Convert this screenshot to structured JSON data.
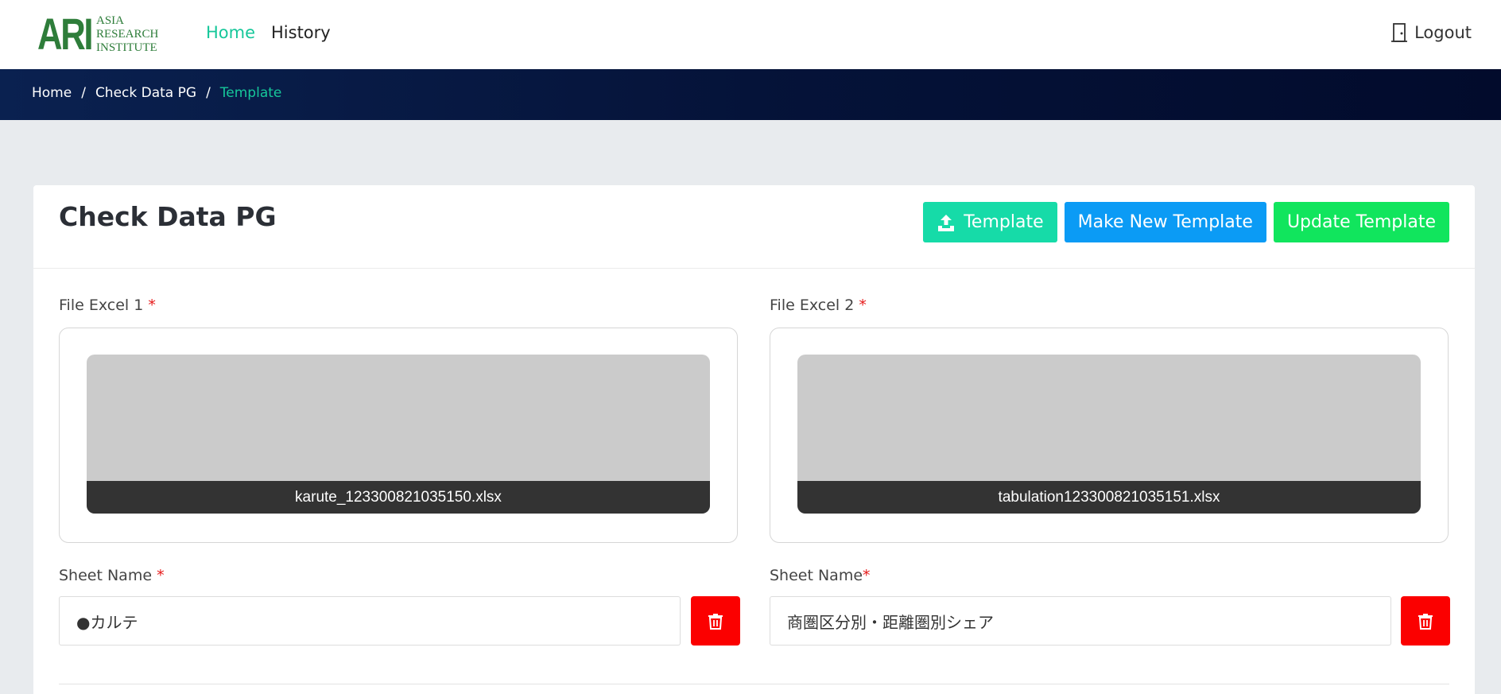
{
  "logo": {
    "mark": "ARI",
    "line1": "ASIA",
    "line2": "RESEARCH",
    "line3": "INSTITUTE"
  },
  "nav": {
    "home": "Home",
    "history": "History",
    "logout": "Logout"
  },
  "breadcrumb": {
    "home": "Home",
    "section": "Check Data PG",
    "current": "Template",
    "separator": "/"
  },
  "page": {
    "title": "Check Data PG",
    "buttons": {
      "template": "Template",
      "make_new": "Make New Template",
      "update": "Update Template"
    }
  },
  "file1": {
    "label": "File Excel 1",
    "required": "*",
    "filename": "karute_123300821035150.xlsx"
  },
  "file2": {
    "label": "File Excel 2",
    "required": "*",
    "filename": "tabulation123300821035151.xlsx"
  },
  "sheet1": {
    "label": "Sheet Name",
    "required": "*",
    "value": "●カルテ"
  },
  "sheet2": {
    "label": "Sheet Name",
    "required": "*",
    "value": "商圏区分別・距離圏別シェア"
  },
  "colors": {
    "accent": "#16c79a",
    "teal_button": "#16dba8",
    "blue_button": "#0b9bf5",
    "green_button": "#11e55d",
    "delete": "#fb0000",
    "navbar": "#051339"
  },
  "icons": {
    "upload": "upload-icon",
    "door": "door-icon",
    "trash": "trash-icon"
  }
}
